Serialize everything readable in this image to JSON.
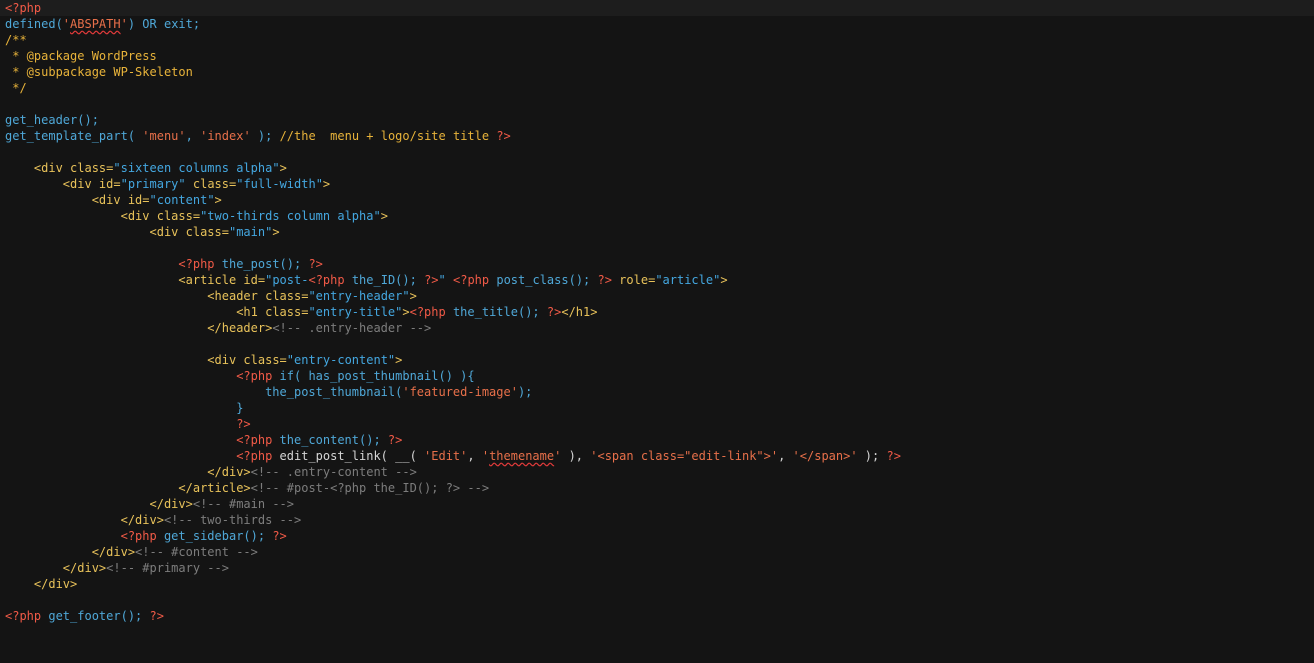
{
  "colors": {
    "background": "#141414",
    "current_line": "#1d1d1d",
    "php_tag": "#f15a47",
    "function": "#4fa8d8",
    "plain": "#d5d5d5",
    "comment_doc": "#e8b33a",
    "tag": "#e8c25a",
    "attr": "#e8c25a",
    "string": "#44a7e0",
    "php_string": "#e8704a",
    "html_comment": "#7d7d7d",
    "keyword": "#e8c25a"
  },
  "code": {
    "lines": [
      [
        {
          "t": "<?php",
          "c": "php_tag"
        }
      ],
      [
        {
          "t": "defined(",
          "c": "function"
        },
        {
          "t": "'",
          "c": "php_string"
        },
        {
          "t": "ABSPATH",
          "c": "php_string",
          "sq": true
        },
        {
          "t": "'",
          "c": "php_string"
        },
        {
          "t": ") OR exit;",
          "c": "function"
        }
      ],
      [
        {
          "t": "/**",
          "c": "comment_doc"
        }
      ],
      [
        {
          "t": " * @package WordPress",
          "c": "comment_doc"
        }
      ],
      [
        {
          "t": " * @subpackage WP-Skeleton",
          "c": "comment_doc"
        }
      ],
      [
        {
          "t": " */",
          "c": "comment_doc"
        }
      ],
      [],
      [
        {
          "t": "get_header();",
          "c": "function"
        }
      ],
      [
        {
          "t": "get_template_part( ",
          "c": "function"
        },
        {
          "t": "'menu'",
          "c": "php_string"
        },
        {
          "t": ", ",
          "c": "function"
        },
        {
          "t": "'index'",
          "c": "php_string"
        },
        {
          "t": " ); ",
          "c": "function"
        },
        {
          "t": "//the  menu + logo/site title ",
          "c": "comment_doc"
        },
        {
          "t": "?>",
          "c": "php_tag"
        }
      ],
      [],
      [
        {
          "t": "    <div ",
          "c": "tag"
        },
        {
          "t": "class=",
          "c": "attr"
        },
        {
          "t": "\"sixteen columns alpha\"",
          "c": "string"
        },
        {
          "t": ">",
          "c": "tag"
        }
      ],
      [
        {
          "t": "        <div ",
          "c": "tag"
        },
        {
          "t": "id=",
          "c": "attr"
        },
        {
          "t": "\"primary\"",
          "c": "string"
        },
        {
          "t": " class=",
          "c": "attr"
        },
        {
          "t": "\"full-width\"",
          "c": "string"
        },
        {
          "t": ">",
          "c": "tag"
        }
      ],
      [
        {
          "t": "            <div ",
          "c": "tag"
        },
        {
          "t": "id=",
          "c": "attr"
        },
        {
          "t": "\"content\"",
          "c": "string"
        },
        {
          "t": ">",
          "c": "tag"
        }
      ],
      [
        {
          "t": "                <div ",
          "c": "tag"
        },
        {
          "t": "class=",
          "c": "attr"
        },
        {
          "t": "\"two-thirds column alpha\"",
          "c": "string"
        },
        {
          "t": ">",
          "c": "tag"
        }
      ],
      [
        {
          "t": "                    <div ",
          "c": "tag"
        },
        {
          "t": "class=",
          "c": "attr"
        },
        {
          "t": "\"main\"",
          "c": "string"
        },
        {
          "t": ">",
          "c": "tag"
        }
      ],
      [],
      [
        {
          "t": "                        ",
          "c": "plain"
        },
        {
          "t": "<?php",
          "c": "php_tag"
        },
        {
          "t": " the_post(); ",
          "c": "function"
        },
        {
          "t": "?>",
          "c": "php_tag"
        }
      ],
      [
        {
          "t": "                        <article ",
          "c": "tag"
        },
        {
          "t": "id=",
          "c": "attr"
        },
        {
          "t": "\"post-",
          "c": "string"
        },
        {
          "t": "<?php",
          "c": "php_tag"
        },
        {
          "t": " the_ID(); ",
          "c": "function"
        },
        {
          "t": "?>",
          "c": "php_tag"
        },
        {
          "t": "\"",
          "c": "string"
        },
        {
          "t": " ",
          "c": "plain"
        },
        {
          "t": "<?php",
          "c": "php_tag"
        },
        {
          "t": " post_class(); ",
          "c": "function"
        },
        {
          "t": "?>",
          "c": "php_tag"
        },
        {
          "t": " role=",
          "c": "attr"
        },
        {
          "t": "\"article\"",
          "c": "string"
        },
        {
          "t": ">",
          "c": "tag"
        }
      ],
      [
        {
          "t": "                            <header ",
          "c": "tag"
        },
        {
          "t": "class=",
          "c": "attr"
        },
        {
          "t": "\"entry-header\"",
          "c": "string"
        },
        {
          "t": ">",
          "c": "tag"
        }
      ],
      [
        {
          "t": "                                <h1 ",
          "c": "tag"
        },
        {
          "t": "class=",
          "c": "attr"
        },
        {
          "t": "\"entry-title\"",
          "c": "string"
        },
        {
          "t": ">",
          "c": "tag"
        },
        {
          "t": "<?php",
          "c": "php_tag"
        },
        {
          "t": " the_title(); ",
          "c": "function"
        },
        {
          "t": "?>",
          "c": "php_tag"
        },
        {
          "t": "</h1>",
          "c": "tag"
        }
      ],
      [
        {
          "t": "                            </header>",
          "c": "tag"
        },
        {
          "t": "<!-- .entry-header -->",
          "c": "html_comment"
        }
      ],
      [],
      [
        {
          "t": "                            <div ",
          "c": "tag"
        },
        {
          "t": "class=",
          "c": "attr"
        },
        {
          "t": "\"entry-content\"",
          "c": "string"
        },
        {
          "t": ">",
          "c": "tag"
        }
      ],
      [
        {
          "t": "                                ",
          "c": "plain"
        },
        {
          "t": "<?php",
          "c": "php_tag"
        },
        {
          "t": " if( ",
          "c": "function"
        },
        {
          "t": "has_post_thumbnail() ){",
          "c": "function"
        }
      ],
      [
        {
          "t": "                                    the_post_thumbnail(",
          "c": "function"
        },
        {
          "t": "'featured-image'",
          "c": "php_string"
        },
        {
          "t": ");",
          "c": "function"
        }
      ],
      [
        {
          "t": "                                }",
          "c": "function"
        }
      ],
      [
        {
          "t": "                                ",
          "c": "plain"
        },
        {
          "t": "?>",
          "c": "php_tag"
        }
      ],
      [
        {
          "t": "                                ",
          "c": "plain"
        },
        {
          "t": "<?php",
          "c": "php_tag"
        },
        {
          "t": " the_content(); ",
          "c": "function"
        },
        {
          "t": "?>",
          "c": "php_tag"
        }
      ],
      [
        {
          "t": "                                ",
          "c": "plain"
        },
        {
          "t": "<?php",
          "c": "php_tag"
        },
        {
          "t": " edit_post_link( __( ",
          "c": "plain"
        },
        {
          "t": "'Edit'",
          "c": "php_string"
        },
        {
          "t": ", ",
          "c": "plain"
        },
        {
          "t": "'",
          "c": "php_string"
        },
        {
          "t": "themename",
          "c": "php_string",
          "sq": true
        },
        {
          "t": "'",
          "c": "php_string"
        },
        {
          "t": " ), ",
          "c": "plain"
        },
        {
          "t": "'<span class=\"edit-link\">'",
          "c": "php_string"
        },
        {
          "t": ", ",
          "c": "plain"
        },
        {
          "t": "'</span>'",
          "c": "php_string"
        },
        {
          "t": " ); ",
          "c": "plain"
        },
        {
          "t": "?>",
          "c": "php_tag"
        }
      ],
      [
        {
          "t": "                            </div>",
          "c": "tag"
        },
        {
          "t": "<!-- .entry-content -->",
          "c": "html_comment"
        }
      ],
      [
        {
          "t": "                        </article>",
          "c": "tag"
        },
        {
          "t": "<!-- #post-<?php the_ID(); ?> -->",
          "c": "html_comment"
        }
      ],
      [
        {
          "t": "                    </div>",
          "c": "tag"
        },
        {
          "t": "<!-- #main -->",
          "c": "html_comment"
        }
      ],
      [
        {
          "t": "                </div>",
          "c": "tag"
        },
        {
          "t": "<!-- two-thirds -->",
          "c": "html_comment"
        }
      ],
      [
        {
          "t": "                ",
          "c": "plain"
        },
        {
          "t": "<?php",
          "c": "php_tag"
        },
        {
          "t": " get_sidebar(); ",
          "c": "function"
        },
        {
          "t": "?>",
          "c": "php_tag"
        }
      ],
      [
        {
          "t": "            </div>",
          "c": "tag"
        },
        {
          "t": "<!-- #content -->",
          "c": "html_comment"
        }
      ],
      [
        {
          "t": "        </div>",
          "c": "tag"
        },
        {
          "t": "<!-- #primary -->",
          "c": "html_comment"
        }
      ],
      [
        {
          "t": "    </div>",
          "c": "tag"
        }
      ],
      [],
      [
        {
          "t": "<?php",
          "c": "php_tag"
        },
        {
          "t": " get_footer(); ",
          "c": "function"
        },
        {
          "t": "?>",
          "c": "php_tag"
        }
      ]
    ]
  }
}
